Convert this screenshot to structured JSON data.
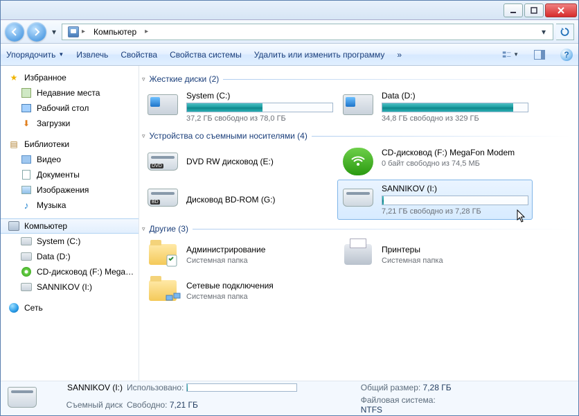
{
  "titlebar": {
    "min": "_",
    "max": "▢",
    "close": "✕"
  },
  "nav": {
    "root_label": "Компьютер",
    "arrow": "▸",
    "dropdown": "▾",
    "refresh": "↻"
  },
  "toolbar": {
    "organize": "Упорядочить",
    "eject": "Извлечь",
    "properties": "Свойства",
    "sysprops": "Свойства системы",
    "uninstall": "Удалить или изменить программу",
    "more": "»"
  },
  "sidebar": {
    "favorites": "Избранное",
    "recent": "Недавние места",
    "desktop": "Рабочий стол",
    "downloads": "Загрузки",
    "libraries": "Библиотеки",
    "videos": "Видео",
    "documents": "Документы",
    "pictures": "Изображения",
    "music": "Музыка",
    "computer": "Компьютер",
    "systemc": "System (C:)",
    "datad": "Data (D:)",
    "cdf": "CD-дисковод (F:) MegaFon",
    "sann": "SANNIKOV (I:)",
    "network": "Сеть"
  },
  "sections": {
    "hdd": "Жесткие диски (2)",
    "removable": "Устройства со съемными носителями (4)",
    "other": "Другие (3)"
  },
  "drives": {
    "systemc": {
      "name": "System (C:)",
      "free": "37,2 ГБ свободно из 78,0 ГБ",
      "pct": 52
    },
    "datad": {
      "name": "Data (D:)",
      "free": "34,8 ГБ свободно из 329 ГБ",
      "pct": 90
    },
    "dvd": {
      "name": "DVD RW дисковод (E:)"
    },
    "cdmod": {
      "name": "CD-дисковод (F:) MegaFon Modem",
      "free": "0 байт свободно из 74,5 МБ"
    },
    "bd": {
      "name": "Дисковод BD-ROM (G:)"
    },
    "sann": {
      "name": "SANNIKOV (I:)",
      "free": "7,21 ГБ свободно из 7,28 ГБ",
      "pct": 1
    }
  },
  "other": {
    "admin": {
      "name": "Администрирование",
      "sub": "Системная папка"
    },
    "printers": {
      "name": "Принтеры",
      "sub": "Системная папка"
    },
    "netconn": {
      "name": "Сетевые подключения",
      "sub": "Системная папка"
    }
  },
  "status": {
    "title": "SANNIKOV (I:)",
    "type": "Съемный диск",
    "used_lbl": "Использовано:",
    "free_lbl": "Свободно:",
    "free_val": "7,21 ГБ",
    "size_lbl": "Общий размер:",
    "size_val": "7,28 ГБ",
    "fs_lbl": "Файловая система:",
    "fs_val": "NTFS",
    "used_pct": 1
  }
}
